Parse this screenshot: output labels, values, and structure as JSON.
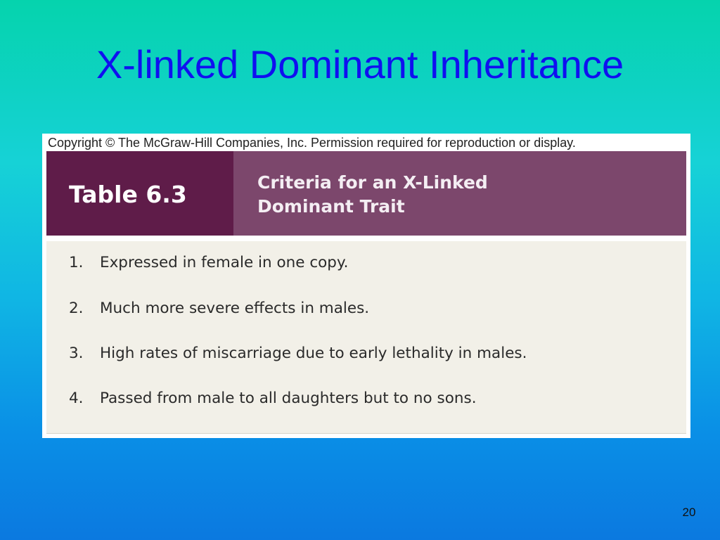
{
  "slide": {
    "title": "X-linked Dominant Inheritance",
    "page_number": "20"
  },
  "figure": {
    "copyright": "Copyright © The McGraw-Hill Companies, Inc. Permission required for reproduction or display.",
    "table_number": "Table 6.3",
    "caption_line1": "Criteria for an X-Linked",
    "caption_line2": "Dominant Trait",
    "criteria": [
      {
        "num": "1.",
        "text": "Expressed in female in one copy."
      },
      {
        "num": "2.",
        "text": "Much more severe effects in males."
      },
      {
        "num": "3.",
        "text": "High rates of miscarriage due to early lethality in males."
      },
      {
        "num": "4.",
        "text": "Passed from male to all daughters but to no sons."
      }
    ]
  },
  "colors": {
    "title": "#1010f0",
    "header_dark": "#5f1c49",
    "header_light": "#7c476c",
    "table_body": "#f2f0e8"
  }
}
